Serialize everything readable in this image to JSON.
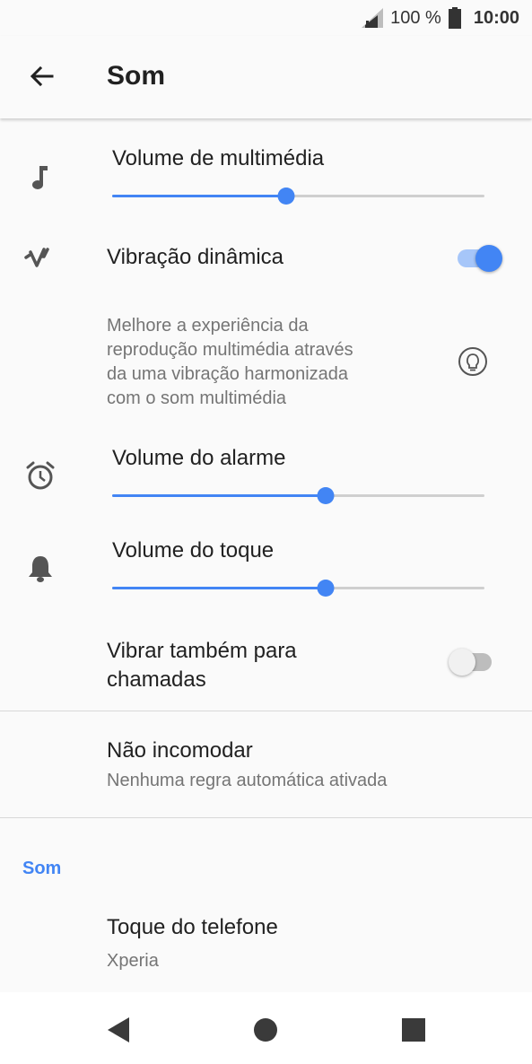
{
  "status": {
    "battery_percent": "100 %",
    "time": "10:00"
  },
  "header": {
    "title": "Som"
  },
  "media_volume": {
    "label": "Volume de multimédia",
    "level": 0.467
  },
  "dynamic_vibration": {
    "label": "Vibração dinâmica",
    "enabled": true,
    "description_lines": [
      "Melhore a experiência da",
      "reprodução multimédia através",
      "da uma vibração harmonizada",
      "com o som multimédia"
    ]
  },
  "alarm_volume": {
    "label": "Volume do alarme",
    "level": 0.573
  },
  "ring_volume": {
    "label": "Volume do toque",
    "level": 0.573
  },
  "vibrate_for_calls": {
    "label_lines": [
      "Vibrar também para",
      "chamadas"
    ],
    "enabled": false
  },
  "do_not_disturb": {
    "label": "Não incomodar",
    "summary": "Nenhuma regra automática ativada"
  },
  "section_sound": {
    "label": "Som"
  },
  "phone_ringtone": {
    "label": "Toque do telefone",
    "summary": "Xperia"
  },
  "colors": {
    "accent": "#4285f4"
  },
  "icons": {
    "status": [
      "signal-icon",
      "battery-icon"
    ],
    "rows": [
      "music-note-icon",
      "vibration-icon",
      "lightbulb-icon",
      "alarm-clock-icon",
      "bell-icon"
    ],
    "nav": [
      "back-triangle-icon",
      "home-circle-icon",
      "recents-square-icon"
    ]
  }
}
